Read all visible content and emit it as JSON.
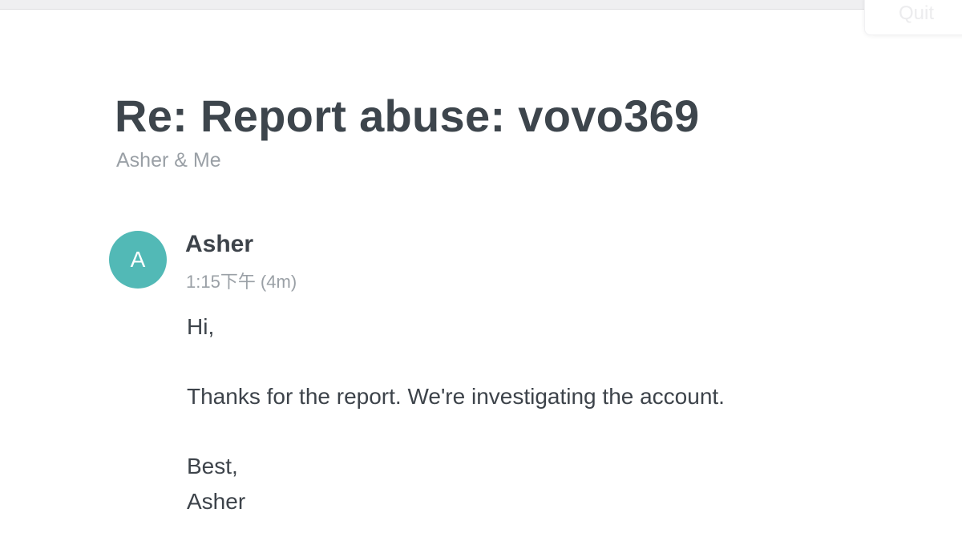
{
  "toolbar": {
    "quit_label": "Quit"
  },
  "thread": {
    "subject": "Re: Report abuse: vovo369",
    "participants": "Asher & Me"
  },
  "message": {
    "avatar_initial": "A",
    "avatar_color": "#52b9b6",
    "sender": "Asher",
    "time": "1:15下午 (4m)",
    "body_lines": [
      "Hi,",
      "",
      "Thanks for the report. We're investigating the account.",
      "",
      "Best,",
      "Asher"
    ]
  }
}
